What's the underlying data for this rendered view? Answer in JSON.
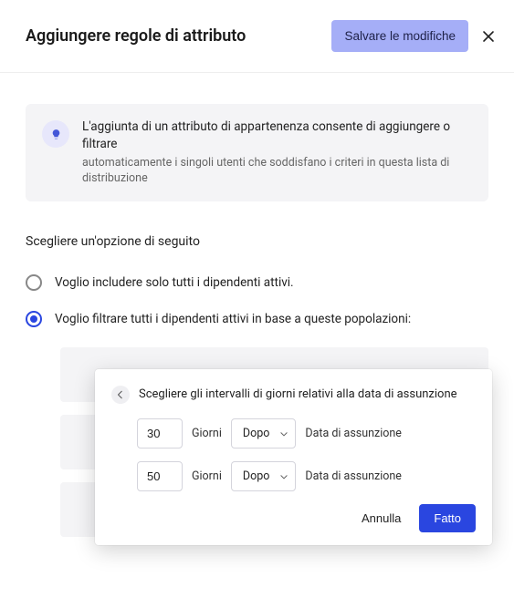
{
  "header": {
    "title": "Aggiungere regole di attributo",
    "save_label": "Salvare le modifiche"
  },
  "info": {
    "line1": "L'aggiunta di un attributo di appartenenza consente di aggiungere o filtrare",
    "line2": "automaticamente i singoli utenti che soddisfano i criteri in questa lista di distribuzione"
  },
  "choose_heading": "Scegliere un'opzione di seguito",
  "radios": {
    "include_all": "Voglio includere solo tutti i dipendenti attivi.",
    "filter_pop": "Voglio filtrare tutti i dipendenti attivi in base a queste popolazioni:"
  },
  "popup": {
    "title": "Scegliere gli intervalli di giorni relativi alla data di assunzione",
    "intervals": [
      {
        "value": "30",
        "unit": "Giorni",
        "direction": "Dopo",
        "anchor": "Data di assunzione"
      },
      {
        "value": "50",
        "unit": "Giorni",
        "direction": "Dopo",
        "anchor": "Data di assunzione"
      }
    ],
    "cancel": "Annulla",
    "done": "Fatto"
  }
}
